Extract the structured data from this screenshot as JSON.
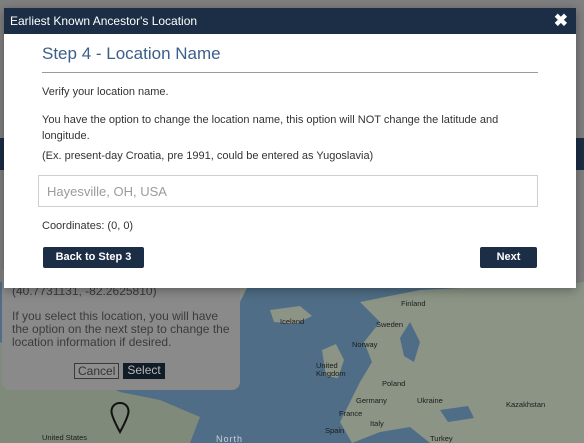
{
  "modal": {
    "title": "Earliest Known Ancestor's Location",
    "close_icon": "close-icon",
    "step_title": "Step 4 - Location Name",
    "verify_text": "Verify your location name.",
    "option_text": "You have the option to change the location name, this option will NOT change the latitude and longitude.",
    "example_text": "(Ex. present-day Croatia, pre 1991, could be entered as Yugoslavia)",
    "location_input": {
      "value": "",
      "placeholder": "Hayesville, OH, USA"
    },
    "coordinates_text": "Coordinates: (0, 0)",
    "back_button": "Back to Step 3",
    "next_button": "Next"
  },
  "background": {
    "infowindow": {
      "coords_text": "(40.7731131, -82.2625810)",
      "message": "If you select this location, you will have the option on the next step to change the location information if desired.",
      "cancel_label": "Cancel",
      "select_label": "Select"
    },
    "map_labels": {
      "finland": "Finland",
      "iceland": "Iceland",
      "sweden": "Sweden",
      "norway": "Norway",
      "united_kingdom": "United Kingdom",
      "poland": "Poland",
      "germany": "Germany",
      "ukraine": "Ukraine",
      "kazakhstan": "Kazakhstan",
      "france": "France",
      "italy": "Italy",
      "spain": "Spain",
      "turkey": "Turkey",
      "united_states": "United States",
      "north": "North"
    },
    "pin_icon": "map-pin-icon",
    "colors": {
      "header": "#1c2e45",
      "accent_title": "#3a5f8a",
      "overlay": "#808080"
    }
  }
}
